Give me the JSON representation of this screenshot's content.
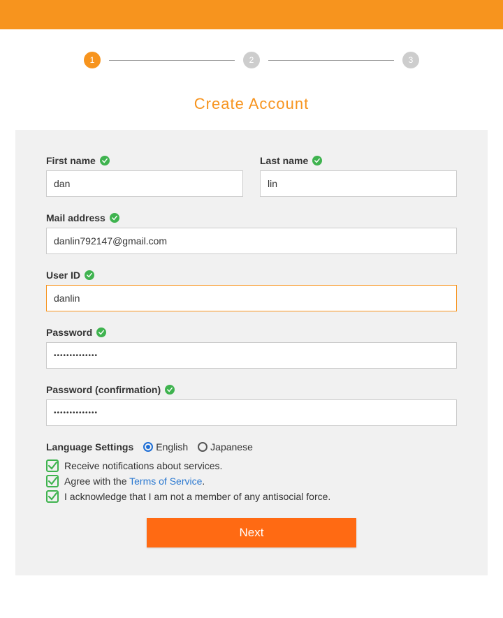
{
  "stepper": {
    "steps": [
      "1",
      "2",
      "3"
    ],
    "active": 1
  },
  "title": "Create Account",
  "fields": {
    "first_name": {
      "label": "First name",
      "value": "dan",
      "valid": true
    },
    "last_name": {
      "label": "Last name",
      "value": "lin",
      "valid": true
    },
    "mail": {
      "label": "Mail address",
      "value": "danlin792147@gmail.com",
      "valid": true
    },
    "user_id": {
      "label": "User ID",
      "value": "danlin",
      "valid": true,
      "focused": true
    },
    "password": {
      "label": "Password",
      "value": "••••••••••••••",
      "valid": true
    },
    "password_confirm": {
      "label": "Password (confirmation)",
      "value": "••••••••••••••",
      "valid": true
    }
  },
  "language": {
    "label": "Language Settings",
    "options": [
      {
        "label": "English",
        "checked": true
      },
      {
        "label": "Japanese",
        "checked": false
      }
    ]
  },
  "checks": {
    "notifications": "Receive notifications about services.",
    "agree_prefix": "Agree with the ",
    "tos_link": "Terms of Service",
    "agree_suffix": ".",
    "antisocial": "I acknowledge that I am not a member of any antisocial force."
  },
  "buttons": {
    "next": "Next"
  }
}
